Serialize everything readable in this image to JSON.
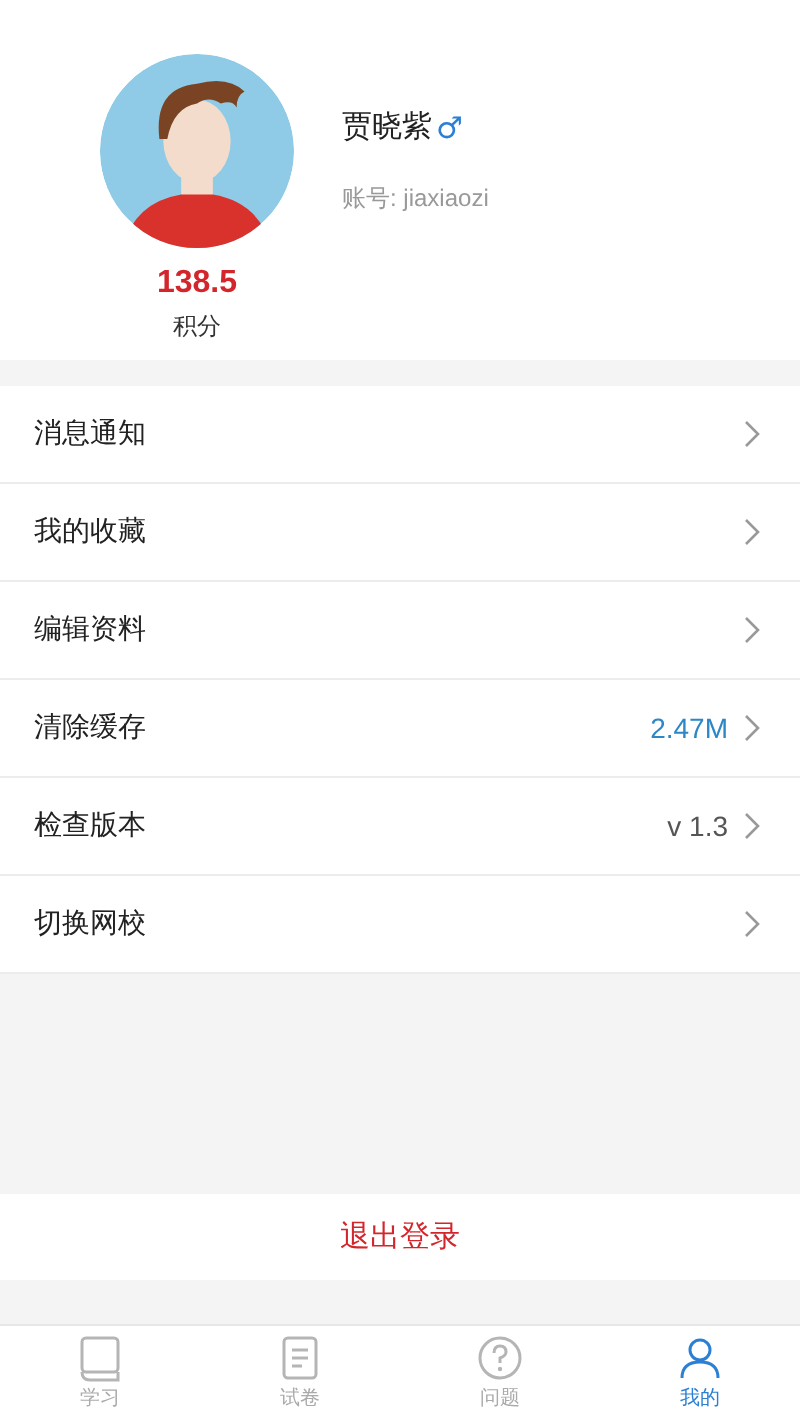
{
  "profile": {
    "name": "贾晓紫",
    "gender_symbol": "♂",
    "account": "账号: jiaxiaozi",
    "points": "138.5",
    "points_label": "积分"
  },
  "menu": [
    {
      "label": "消息通知"
    },
    {
      "label": "我的收藏"
    },
    {
      "label": "编辑资料"
    },
    {
      "label": "清除缓存",
      "value": "2.47M",
      "color": "#2b87c8"
    },
    {
      "label": "检查版本",
      "value": "v 1.3",
      "color": "#555555"
    },
    {
      "label": "切换网校"
    }
  ],
  "logout": "退出登录",
  "tabs": [
    {
      "label": "学习",
      "selected": false
    },
    {
      "label": "试卷",
      "selected": false
    },
    {
      "label": "问题",
      "selected": false
    },
    {
      "label": "我的",
      "selected": true
    }
  ]
}
